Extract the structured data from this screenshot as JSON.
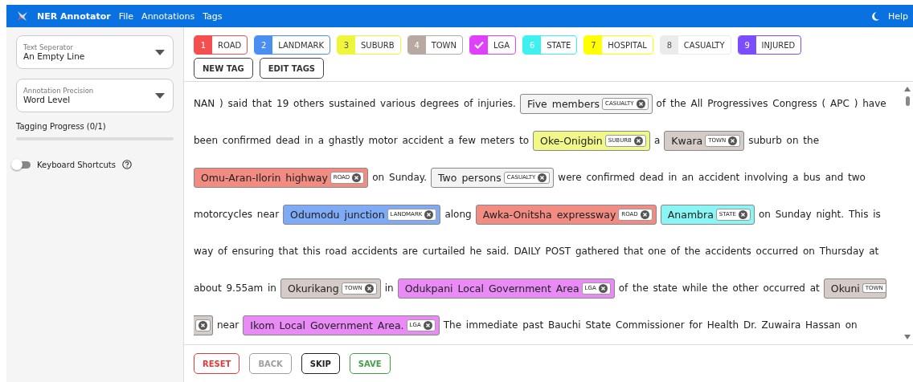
{
  "navbar": {
    "title": "NER Annotator",
    "menu": [
      "File",
      "Annotations",
      "Tags"
    ],
    "help": "Help"
  },
  "sidebar": {
    "selects": [
      {
        "label": "Text Seperator",
        "value": "An Empty Line"
      },
      {
        "label": "Annotation Precision",
        "value": "Word Level"
      }
    ],
    "progress": {
      "label": "Tagging Progress (0/1)",
      "level": 0
    },
    "shortcuts": {
      "label": "Keyboard Shortcuts",
      "on": false
    }
  },
  "tags": [
    {
      "key": "1",
      "name": "ROAD",
      "color": "#f44e4e",
      "selected": false
    },
    {
      "key": "2",
      "name": "LANDMARK",
      "color": "#4a8ef2",
      "selected": false
    },
    {
      "key": "3",
      "name": "SUBURB",
      "color": "#eef53b",
      "selected": false
    },
    {
      "key": "4",
      "name": "TOWN",
      "color": "#b8a8a2",
      "selected": false
    },
    {
      "name": "LGA",
      "color": "#e040fb",
      "selected": true
    },
    {
      "key": "6",
      "name": "STATE",
      "color": "#3ff0f0",
      "selected": false
    },
    {
      "key": "7",
      "name": "HOSPITAL",
      "color": "#ffff00",
      "selected": false
    },
    {
      "key": "8",
      "name": "CASUALTY",
      "color": "#ebebeb",
      "selected": false
    },
    {
      "key": "9",
      "name": "INJURED",
      "color": "#7c4dff",
      "selected": false
    }
  ],
  "tag_buttons": [
    "NEW TAG",
    "EDIT TAGS"
  ],
  "lines": [
    [
      {
        "kind": "text",
        "text": "NAN ) said that 19 others sustained various degrees of injuries."
      },
      {
        "kind": "entity",
        "text": "Five members",
        "label": "CASUALTY",
        "color": "#f3f3f3"
      },
      {
        "kind": "text",
        "text": "of the All Progressives Congress ( APC ) have"
      }
    ],
    [
      {
        "kind": "text",
        "text": "been confirmed dead in a ghastly motor accident a few meters to"
      },
      {
        "kind": "entity",
        "text": "Oke-Onigbin",
        "label": "SUBURB",
        "color": "#f2f78a"
      },
      {
        "kind": "text",
        "text": "a"
      },
      {
        "kind": "entity",
        "text": "Kwara",
        "label": "TOWN",
        "color": "#d5cbc7"
      },
      {
        "kind": "text",
        "text": "suburb on the"
      }
    ],
    [
      {
        "kind": "entity",
        "text": "Omu-Aran-Ilorin highway",
        "label": "ROAD",
        "color": "#f28b82"
      },
      {
        "kind": "text",
        "text": "on Sunday."
      },
      {
        "kind": "entity",
        "text": "Two persons",
        "label": "CASUALTY",
        "color": "#f3f3f3"
      },
      {
        "kind": "text",
        "text": "were confirmed dead in an accident involving a bus and two"
      }
    ],
    [
      {
        "kind": "text",
        "text": "motorcycles near"
      },
      {
        "kind": "entity",
        "text": "Odumodu junction",
        "label": "LANDMARK",
        "color": "#7eaaf6"
      },
      {
        "kind": "text",
        "text": "along"
      },
      {
        "kind": "entity",
        "text": "Awka-Onitsha expressway",
        "label": "ROAD",
        "color": "#f28b82"
      },
      {
        "kind": "entity",
        "text": "Anambra",
        "label": "STATE",
        "color": "#8af5f5"
      },
      {
        "kind": "text",
        "text": "on Sunday night. This is"
      }
    ],
    [
      {
        "kind": "text",
        "text": "way of ensuring that this road accidents are curtailed he said. DAILY POST gathered that one of the accidents occurred on Thursday at"
      }
    ],
    [
      {
        "kind": "text",
        "text": "about 9.55am in"
      },
      {
        "kind": "entity",
        "text": "Okurikang",
        "label": "TOWN",
        "color": "#d5cbc7"
      },
      {
        "kind": "text",
        "text": "in"
      },
      {
        "kind": "entity",
        "text": "Odukpani Local Government Area",
        "label": "LGA",
        "color": "#e98af7"
      },
      {
        "kind": "text",
        "text": "of the state while the other occurred at"
      },
      {
        "kind": "entity-head",
        "text": "Okuni",
        "label": "TOWN",
        "color": "#d5cbc7"
      }
    ],
    [
      {
        "kind": "entity-tail",
        "color": "#d5cbc7"
      },
      {
        "kind": "text",
        "text": "near"
      },
      {
        "kind": "entity",
        "text": "Ikom Local Government Area.",
        "label": "LGA",
        "color": "#e98af7"
      },
      {
        "kind": "text",
        "text": "The immediate past Bauchi State Commissioner for Health Dr. Zuwaira Hassan on"
      }
    ]
  ],
  "actions": [
    {
      "label": "RESET",
      "kind": "reset"
    },
    {
      "label": "BACK",
      "kind": "disabled"
    },
    {
      "label": "SKIP",
      "kind": "plain"
    },
    {
      "label": "SAVE",
      "kind": "save"
    }
  ]
}
